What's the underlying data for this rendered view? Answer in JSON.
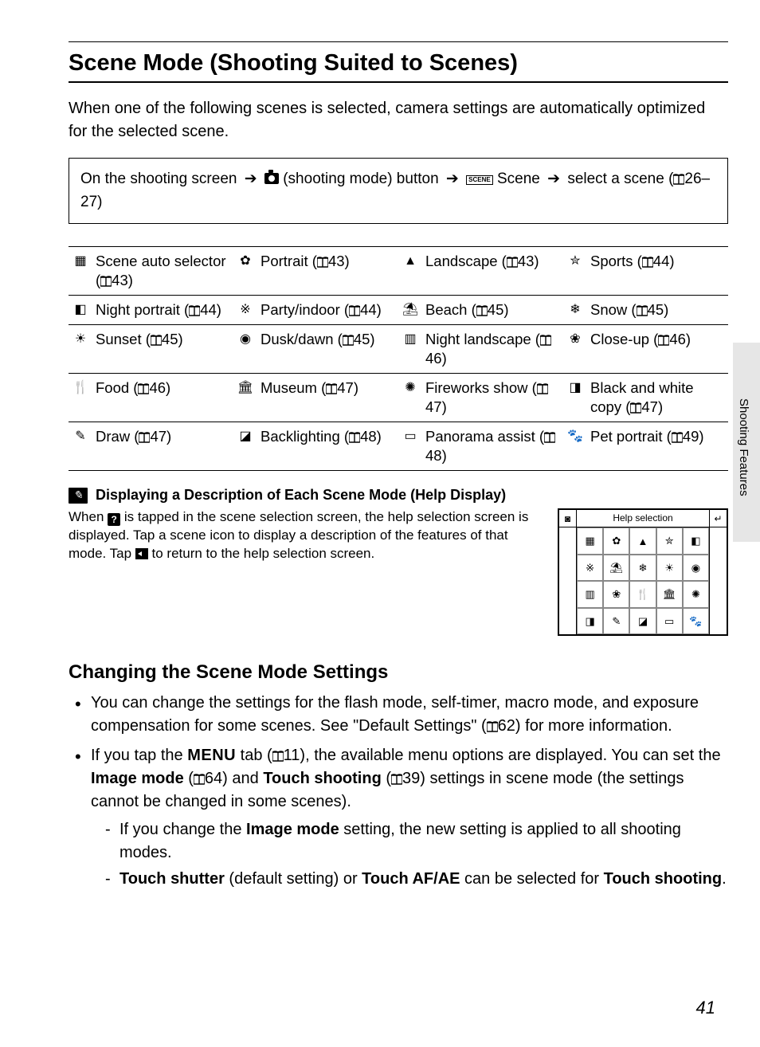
{
  "side_label": "Shooting Features",
  "title": "Scene Mode (Shooting Suited to Scenes)",
  "intro": "When one of the following scenes is selected, camera settings are automatically optimized for the selected scene.",
  "nav": {
    "prefix": "On the shooting screen",
    "mode_btn": "(shooting mode) button",
    "scene_word": "Scene",
    "select": "select a scene",
    "ref": "26–27)"
  },
  "scenes": [
    [
      {
        "icon": "scene-auto-icon",
        "glyph": "▦",
        "name": "Scene auto selector (",
        "ref": "43)"
      },
      {
        "icon": "portrait-icon",
        "glyph": "✿",
        "name": "Portrait",
        "ref": "43)"
      },
      {
        "icon": "landscape-icon",
        "glyph": "▲",
        "name": "Landscape",
        "ref": "43)"
      },
      {
        "icon": "sports-icon",
        "glyph": "✮",
        "name": "Sports",
        "ref": "44)"
      }
    ],
    [
      {
        "icon": "night-portrait-icon",
        "glyph": "◧",
        "name": "Night portrait",
        "ref": "44)"
      },
      {
        "icon": "party-indoor-icon",
        "glyph": "※",
        "name": "Party/indoor",
        "ref": "44)"
      },
      {
        "icon": "beach-icon",
        "glyph": "⛱",
        "name": "Beach",
        "ref": "45)"
      },
      {
        "icon": "snow-icon",
        "glyph": "❄",
        "name": "Snow",
        "ref": "45)"
      }
    ],
    [
      {
        "icon": "sunset-icon",
        "glyph": "☀",
        "name": "Sunset",
        "ref": "45)"
      },
      {
        "icon": "dusk-dawn-icon",
        "glyph": "◉",
        "name": "Dusk/dawn",
        "ref": "45)"
      },
      {
        "icon": "night-landscape-icon",
        "glyph": "▥",
        "name": "Night landscape",
        "ref": "46)"
      },
      {
        "icon": "close-up-icon",
        "glyph": "❀",
        "name": "Close-up",
        "ref": "46)"
      }
    ],
    [
      {
        "icon": "food-icon",
        "glyph": "🍴",
        "name": "Food",
        "ref": "46)"
      },
      {
        "icon": "museum-icon",
        "glyph": "🏛",
        "name": "Museum",
        "ref": "47)"
      },
      {
        "icon": "fireworks-icon",
        "glyph": "✺",
        "name": "Fireworks show",
        "ref": "47)"
      },
      {
        "icon": "bw-copy-icon",
        "glyph": "◨",
        "name": "Black and white copy (",
        "ref": "47)"
      }
    ],
    [
      {
        "icon": "draw-icon",
        "glyph": "✎",
        "name": "Draw",
        "ref": "47)"
      },
      {
        "icon": "backlighting-icon",
        "glyph": "◪",
        "name": "Backlighting",
        "ref": "48)"
      },
      {
        "icon": "panorama-icon",
        "glyph": "▭",
        "name": "Panorama assist",
        "ref": "48)"
      },
      {
        "icon": "pet-portrait-icon",
        "glyph": "🐾",
        "name": "Pet portrait",
        "ref": "49)"
      }
    ]
  ],
  "help": {
    "title": "Displaying a Description of Each Scene Mode (Help Display)",
    "text_before_q": "When ",
    "text_after_q": " is tapped in the scene selection screen, the help selection screen is displayed. Tap a scene icon to display a description of the features of that mode. Tap ",
    "text_after_back": " to return to the help selection screen.",
    "screen_title": "Help selection",
    "grid_glyphs": [
      "▦",
      "✿",
      "▲",
      "✮",
      "◧",
      "※",
      "⛱",
      "❄",
      "☀",
      "◉",
      "▥",
      "❀",
      "🍴",
      "🏛",
      "✺",
      "◨",
      "✎",
      "◪",
      "▭",
      "🐾"
    ]
  },
  "changing": {
    "heading": "Changing the Scene Mode Settings",
    "bullet1_a": "You can change the settings for the flash mode, self-timer, macro mode, and exposure compensation for some scenes. See \"Default Settings\" (",
    "bullet1_ref": "62) for more information.",
    "bullet2_a": "If you tap the ",
    "bullet2_menu": "MENU",
    "bullet2_b": " tab (",
    "bullet2_ref1": "11), the available menu options are displayed. You can set the ",
    "bullet2_img": "Image mode",
    "bullet2_c": " (",
    "bullet2_ref2": "64) and ",
    "bullet2_touch": "Touch shooting",
    "bullet2_d": " (",
    "bullet2_ref3": "39) settings in scene mode (the settings cannot be changed in some scenes).",
    "dash1_a": "If you change the ",
    "dash1_b": " setting, the new setting is applied to all shooting modes.",
    "dash2_ts": "Touch shutter",
    "dash2_a": " (default setting) or ",
    "dash2_af": "Touch AF/AE",
    "dash2_b": " can be selected for ",
    "dash2_tsh": "Touch shooting",
    "dash2_c": "."
  },
  "page_number": "41"
}
